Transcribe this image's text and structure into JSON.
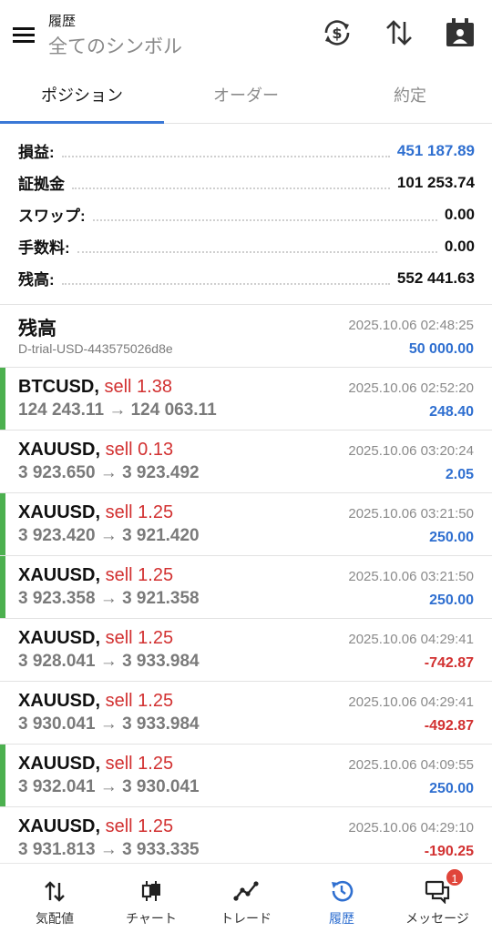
{
  "header": {
    "title": "履歴",
    "subtitle": "全てのシンボル",
    "icons": [
      "menu-icon",
      "currency-exchange-icon",
      "sort-icon",
      "calendar-icon"
    ]
  },
  "tabs": [
    {
      "label": "ポジション",
      "active": true
    },
    {
      "label": "オーダー",
      "active": false
    },
    {
      "label": "約定",
      "active": false
    }
  ],
  "summary": [
    {
      "label": "損益:",
      "value": "451 187.89",
      "highlight": true
    },
    {
      "label": "証拠金",
      "value": "101 253.74",
      "highlight": false
    },
    {
      "label": "スワップ:",
      "value": "0.00",
      "highlight": false
    },
    {
      "label": "手数料:",
      "value": "0.00",
      "highlight": false
    },
    {
      "label": "残高:",
      "value": "552 441.63",
      "highlight": false
    }
  ],
  "balance_entry": {
    "title": "残高",
    "account": "D-trial-USD-443575026d8e",
    "time": "2025.10.06 02:48:25",
    "amount": "50 000.00"
  },
  "deals": [
    {
      "symbol": "BTCUSD,",
      "side": "sell 1.38",
      "prices": "124 243.11 → 124 063.11",
      "time": "2025.10.06 02:52:20",
      "profit": "248.40",
      "positive": true,
      "marker": true
    },
    {
      "symbol": "XAUUSD,",
      "side": "sell 0.13",
      "prices": "3 923.650 → 3 923.492",
      "time": "2025.10.06 03:20:24",
      "profit": "2.05",
      "positive": true,
      "marker": false
    },
    {
      "symbol": "XAUUSD,",
      "side": "sell 1.25",
      "prices": "3 923.420 → 3 921.420",
      "time": "2025.10.06 03:21:50",
      "profit": "250.00",
      "positive": true,
      "marker": true
    },
    {
      "symbol": "XAUUSD,",
      "side": "sell 1.25",
      "prices": "3 923.358 → 3 921.358",
      "time": "2025.10.06 03:21:50",
      "profit": "250.00",
      "positive": true,
      "marker": true
    },
    {
      "symbol": "XAUUSD,",
      "side": "sell 1.25",
      "prices": "3 928.041 → 3 933.984",
      "time": "2025.10.06 04:29:41",
      "profit": "-742.87",
      "positive": false,
      "marker": false
    },
    {
      "symbol": "XAUUSD,",
      "side": "sell 1.25",
      "prices": "3 930.041 → 3 933.984",
      "time": "2025.10.06 04:29:41",
      "profit": "-492.87",
      "positive": false,
      "marker": false
    },
    {
      "symbol": "XAUUSD,",
      "side": "sell 1.25",
      "prices": "3 932.041 → 3 930.041",
      "time": "2025.10.06 04:09:55",
      "profit": "250.00",
      "positive": true,
      "marker": true
    },
    {
      "symbol": "XAUUSD,",
      "side": "sell 1.25",
      "prices": "3 931.813 → 3 933.335",
      "time": "2025.10.06 04:29:10",
      "profit": "-190.25",
      "positive": false,
      "marker": false
    }
  ],
  "colors": {
    "accent": "#2f6fd0",
    "loss": "#d23131",
    "profit_marker": "#4cb04f"
  },
  "bottom_nav": [
    {
      "label": "気配値",
      "icon": "quotes-icon",
      "active": false
    },
    {
      "label": "チャート",
      "icon": "chart-icon",
      "active": false
    },
    {
      "label": "トレード",
      "icon": "trade-icon",
      "active": false
    },
    {
      "label": "履歴",
      "icon": "history-icon",
      "active": true
    },
    {
      "label": "メッセージ",
      "icon": "messages-icon",
      "active": false,
      "badge": "1"
    }
  ]
}
